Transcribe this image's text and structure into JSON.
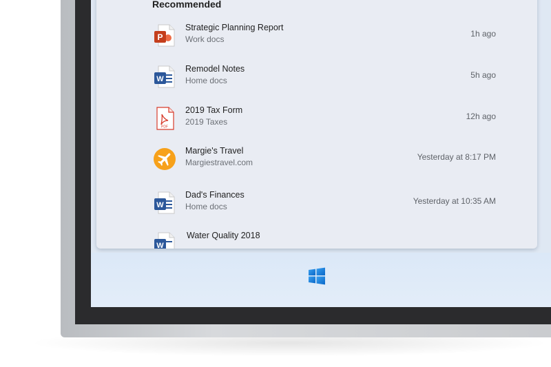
{
  "recommended": {
    "title": "Recommended",
    "items": [
      {
        "name": "Strategic Planning Report",
        "location": "Work docs",
        "time": "1h ago",
        "icon": "powerpoint-icon"
      },
      {
        "name": "Remodel Notes",
        "location": "Home docs",
        "time": "5h ago",
        "icon": "word-icon"
      },
      {
        "name": "2019 Tax Form",
        "location": "2019 Taxes",
        "time": "12h ago",
        "icon": "pdf-icon"
      },
      {
        "name": "Margie's Travel",
        "location": "Margiestravel.com",
        "time": "Yesterday at 8:17 PM",
        "icon": "airplane-icon"
      },
      {
        "name": "Dad's Finances",
        "location": "Home docs",
        "time": "Yesterday at 10:35 AM",
        "icon": "word-icon"
      },
      {
        "name": "Water Quality 2018",
        "location": "",
        "time": "",
        "icon": "word-icon"
      }
    ]
  },
  "taskbar": {
    "start_icon": "windows-logo-icon"
  },
  "colors": {
    "powerpoint": "#c43e1c",
    "word": "#2b579a",
    "pdf": "#d83b2b",
    "travel": "#f7a11a",
    "windows_blue": "#0a7ce0"
  }
}
